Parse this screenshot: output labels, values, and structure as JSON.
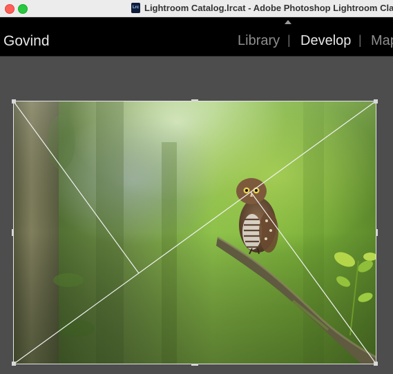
{
  "window": {
    "title": "Lightroom Catalog.lrcat - Adobe Photoshop Lightroom Class",
    "doc_icon_label": "Lrc"
  },
  "header": {
    "identity_plate": "Govind",
    "modules": [
      {
        "label": "Library",
        "active": false
      },
      {
        "label": "Develop",
        "active": true
      },
      {
        "label": "Map",
        "active": false
      }
    ],
    "separator": "|"
  },
  "photo": {
    "subject": "owl on branch",
    "overlay": "diagonal crop guide"
  },
  "colors": {
    "background": "#4d4d4d",
    "header": "#000000",
    "active_module": "#e8e8e8",
    "inactive_module": "#8e8e8e"
  }
}
